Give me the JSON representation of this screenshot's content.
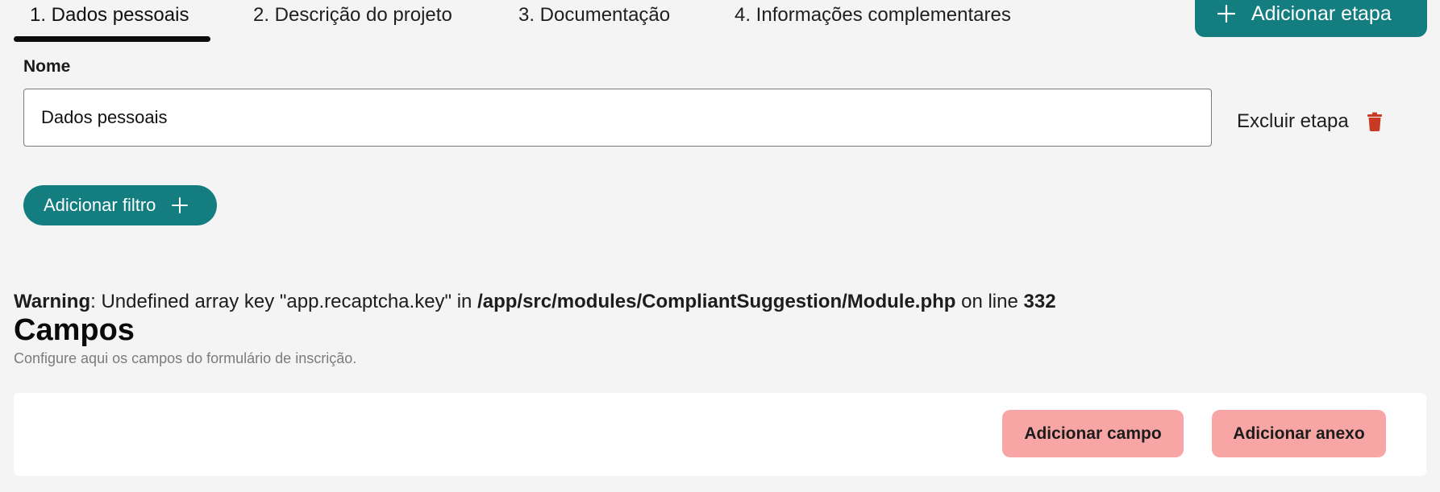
{
  "tabs": [
    {
      "label": "1. Dados pessoais"
    },
    {
      "label": "2. Descrição do projeto"
    },
    {
      "label": "3. Documentação"
    },
    {
      "label": "4. Informações complementares"
    }
  ],
  "active_tab": "1. Dados pessoais",
  "add_step": {
    "label": "Adicionar etapa",
    "icon": "plus-icon"
  },
  "name_field": {
    "label": "Nome",
    "value": "Dados pessoais"
  },
  "delete_step": {
    "label": "Excluir etapa",
    "icon": "trash-icon"
  },
  "add_filter": {
    "label": "Adicionar filtro",
    "icon": "plus-icon"
  },
  "warning": {
    "prefix": "Warning",
    "message": ": Undefined array key \"app.recaptcha.key\" in ",
    "file": "/app/src/modules/CompliantSuggestion/Module.php",
    "line_text": " on line ",
    "line": "332"
  },
  "fields_section": {
    "title": "Campos",
    "subtitle": "Configure aqui os campos do formulário de inscrição.",
    "add_field_label": "Adicionar campo",
    "add_attachment_label": "Adicionar anexo"
  },
  "colors": {
    "primary": "#137d80",
    "danger": "#c93a25",
    "pink": "#f8a5a5",
    "background": "#f4f4f4"
  }
}
